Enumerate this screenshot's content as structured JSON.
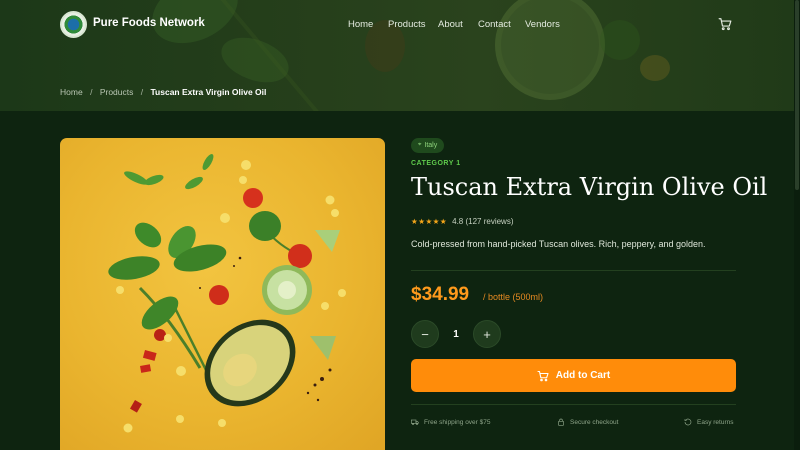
{
  "nav": {
    "brand": "Pure Foods Network",
    "links": [
      "Home",
      "Products",
      "About",
      "Contact",
      "Vendors"
    ],
    "cart_icon": "cart-icon"
  },
  "breadcrumb": {
    "items": [
      "Home",
      "Products"
    ],
    "current": "Tuscan Extra Virgin Olive Oil",
    "separator": "/"
  },
  "product": {
    "origin": "Italy",
    "origin_icon": "map-pin-icon",
    "category": "CATEGORY 1",
    "title": "Tuscan Extra Virgin Olive Oil",
    "rating_stars": 5,
    "rating_text": "4.8 (127 reviews)",
    "description": "Cold-pressed from hand-picked Tuscan olives. Rich, peppery, and golden.",
    "price": "$34.99",
    "unit": "/ bottle (500ml)",
    "quantity": "1",
    "add_to_cart": "Add to Cart"
  },
  "features": [
    {
      "icon": "truck-icon",
      "label": "Free shipping over $75"
    },
    {
      "icon": "lock-icon",
      "label": "Secure checkout"
    },
    {
      "icon": "returns-icon",
      "label": "Easy returns"
    }
  ],
  "colors": {
    "accent": "#ff8c0a",
    "price": "#ff9a1c",
    "category": "#5fcb4c",
    "background": "#0e2410",
    "image_bg": "#eab52f"
  }
}
